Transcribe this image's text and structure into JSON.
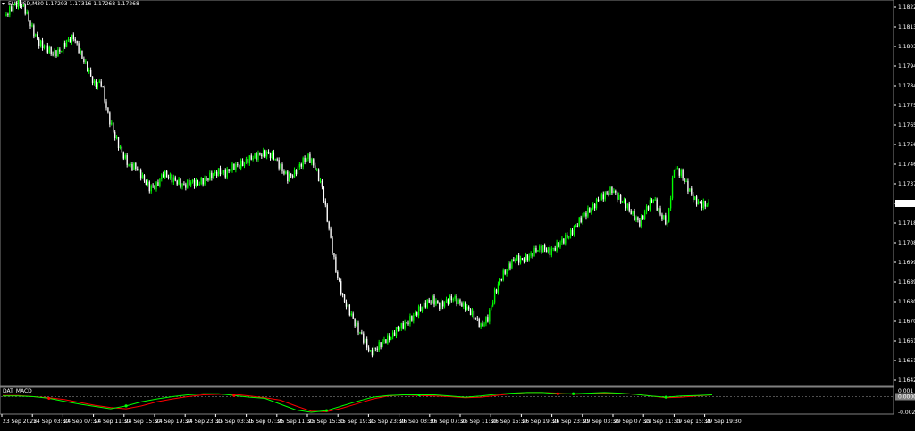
{
  "window": {
    "symbol_header": "EURUSD,M30  1.17293 1.17316 1.17268 1.17268",
    "indicator_name": "DAT_MACD"
  },
  "colors": {
    "background": "#000000",
    "bull_candle": "#00ff00",
    "bear_candle": "#ffffff",
    "macd_main": "#00ff00",
    "macd_signal": "#ff0000",
    "grid": "#808080",
    "current_price_box": "#ffffff"
  },
  "price_axis": {
    "labels": [
      "1.18225",
      "1.18130",
      "1.18035",
      "1.17940",
      "1.17845",
      "1.17750",
      "1.17655",
      "1.17560",
      "1.17465",
      "1.17370",
      "1.17268",
      "1.17180",
      "1.17085",
      "1.16990",
      "1.16895",
      "1.16800",
      "1.16705",
      "1.16610",
      "1.16515",
      "1.16420"
    ],
    "current_price": "1.17268"
  },
  "indicator_axis": {
    "labels": [
      "0.001",
      "0.0000",
      "-0.0027"
    ]
  },
  "time_axis": {
    "labels": [
      "23 Sep 2025",
      "24 Sep 03:30",
      "24 Sep 07:30",
      "24 Sep 11:30",
      "24 Sep 15:30",
      "24 Sep 19:30",
      "24 Sep 23:30",
      "25 Sep 03:30",
      "25 Sep 07:30",
      "25 Sep 11:30",
      "25 Sep 15:30",
      "25 Sep 19:30",
      "25 Sep 23:30",
      "26 Sep 03:30",
      "26 Sep 07:30",
      "26 Sep 11:30",
      "26 Sep 15:30",
      "26 Sep 19:30",
      "26 Sep 23:30",
      "29 Sep 03:30",
      "29 Sep 07:30",
      "29 Sep 11:30",
      "29 Sep 15:30",
      "29 Sep 19:30"
    ]
  },
  "chart_data": {
    "type": "candlestick",
    "symbol": "EURUSD",
    "timeframe": "M30",
    "ylim": [
      1.1642,
      1.18225
    ],
    "close_series": [
      1.1818,
      1.1822,
      1.1825,
      1.1821,
      1.1812,
      1.1805,
      1.1803,
      1.18,
      1.1801,
      1.1806,
      1.1808,
      1.18,
      1.1793,
      1.1785,
      1.1786,
      1.177,
      1.176,
      1.1752,
      1.1746,
      1.1745,
      1.174,
      1.1735,
      1.1736,
      1.1742,
      1.174,
      1.1738,
      1.1736,
      1.1738,
      1.1737,
      1.1739,
      1.1741,
      1.1743,
      1.1742,
      1.1745,
      1.1746,
      1.1748,
      1.175,
      1.1751,
      1.1752,
      1.175,
      1.1745,
      1.174,
      1.1742,
      1.1747,
      1.175,
      1.1745,
      1.1735,
      1.1715,
      1.1695,
      1.1682,
      1.1675,
      1.1668,
      1.1662,
      1.1655,
      1.1658,
      1.1661,
      1.1663,
      1.1667,
      1.1669,
      1.1672,
      1.1676,
      1.1679,
      1.1681,
      1.1678,
      1.168,
      1.1682,
      1.1679,
      1.1677,
      1.1673,
      1.1668,
      1.1672,
      1.1684,
      1.1692,
      1.1697,
      1.1701,
      1.17,
      1.1702,
      1.1705,
      1.1706,
      1.1704,
      1.1707,
      1.171,
      1.1713,
      1.1718,
      1.1722,
      1.1725,
      1.1729,
      1.1732,
      1.1734,
      1.173,
      1.1727,
      1.1722,
      1.1718,
      1.1725,
      1.173,
      1.1722,
      1.1718,
      1.1745,
      1.1742,
      1.1735,
      1.1729,
      1.1727,
      1.1727
    ],
    "macd_main": [
      0.0001,
      0.0001,
      0.0,
      -0.0003,
      -0.0008,
      -0.0013,
      -0.0017,
      -0.0021,
      -0.0016,
      -0.0009,
      -0.0004,
      0.0,
      0.0003,
      0.0005,
      0.0005,
      0.0002,
      -0.0001,
      -0.0003,
      -0.0013,
      -0.0023,
      -0.0027,
      -0.0024,
      -0.0016,
      -0.0008,
      -0.0001,
      0.0002,
      0.0003,
      0.0003,
      0.0003,
      0.0001,
      -0.0001,
      0.0001,
      0.0004,
      0.0006,
      0.0007,
      0.0007,
      0.0005,
      0.0005,
      0.0006,
      0.0007,
      0.0006,
      0.0004,
      0.0001,
      -0.0001,
      0.0001,
      0.0002,
      0.0003
    ],
    "macd_signal": [
      0.0002,
      0.0002,
      0.0,
      -0.0002,
      -0.0005,
      -0.001,
      -0.0015,
      -0.0019,
      -0.0021,
      -0.0016,
      -0.0009,
      -0.0004,
      0.0,
      0.0003,
      0.0004,
      0.0004,
      0.0001,
      -0.0002,
      -0.0006,
      -0.0016,
      -0.0025,
      -0.0026,
      -0.002,
      -0.0012,
      -0.0004,
      0.0001,
      0.0003,
      0.0002,
      0.0001,
      0.0,
      -0.0002,
      -0.0001,
      0.0002,
      0.0005,
      0.0007,
      0.0007,
      0.0006,
      0.0004,
      0.0005,
      0.0006,
      0.0006,
      0.0004,
      0.0001,
      -0.0002,
      -0.0001,
      0.0001,
      0.0003
    ],
    "ylim_indicator": [
      -0.0027,
      0.001
    ]
  }
}
